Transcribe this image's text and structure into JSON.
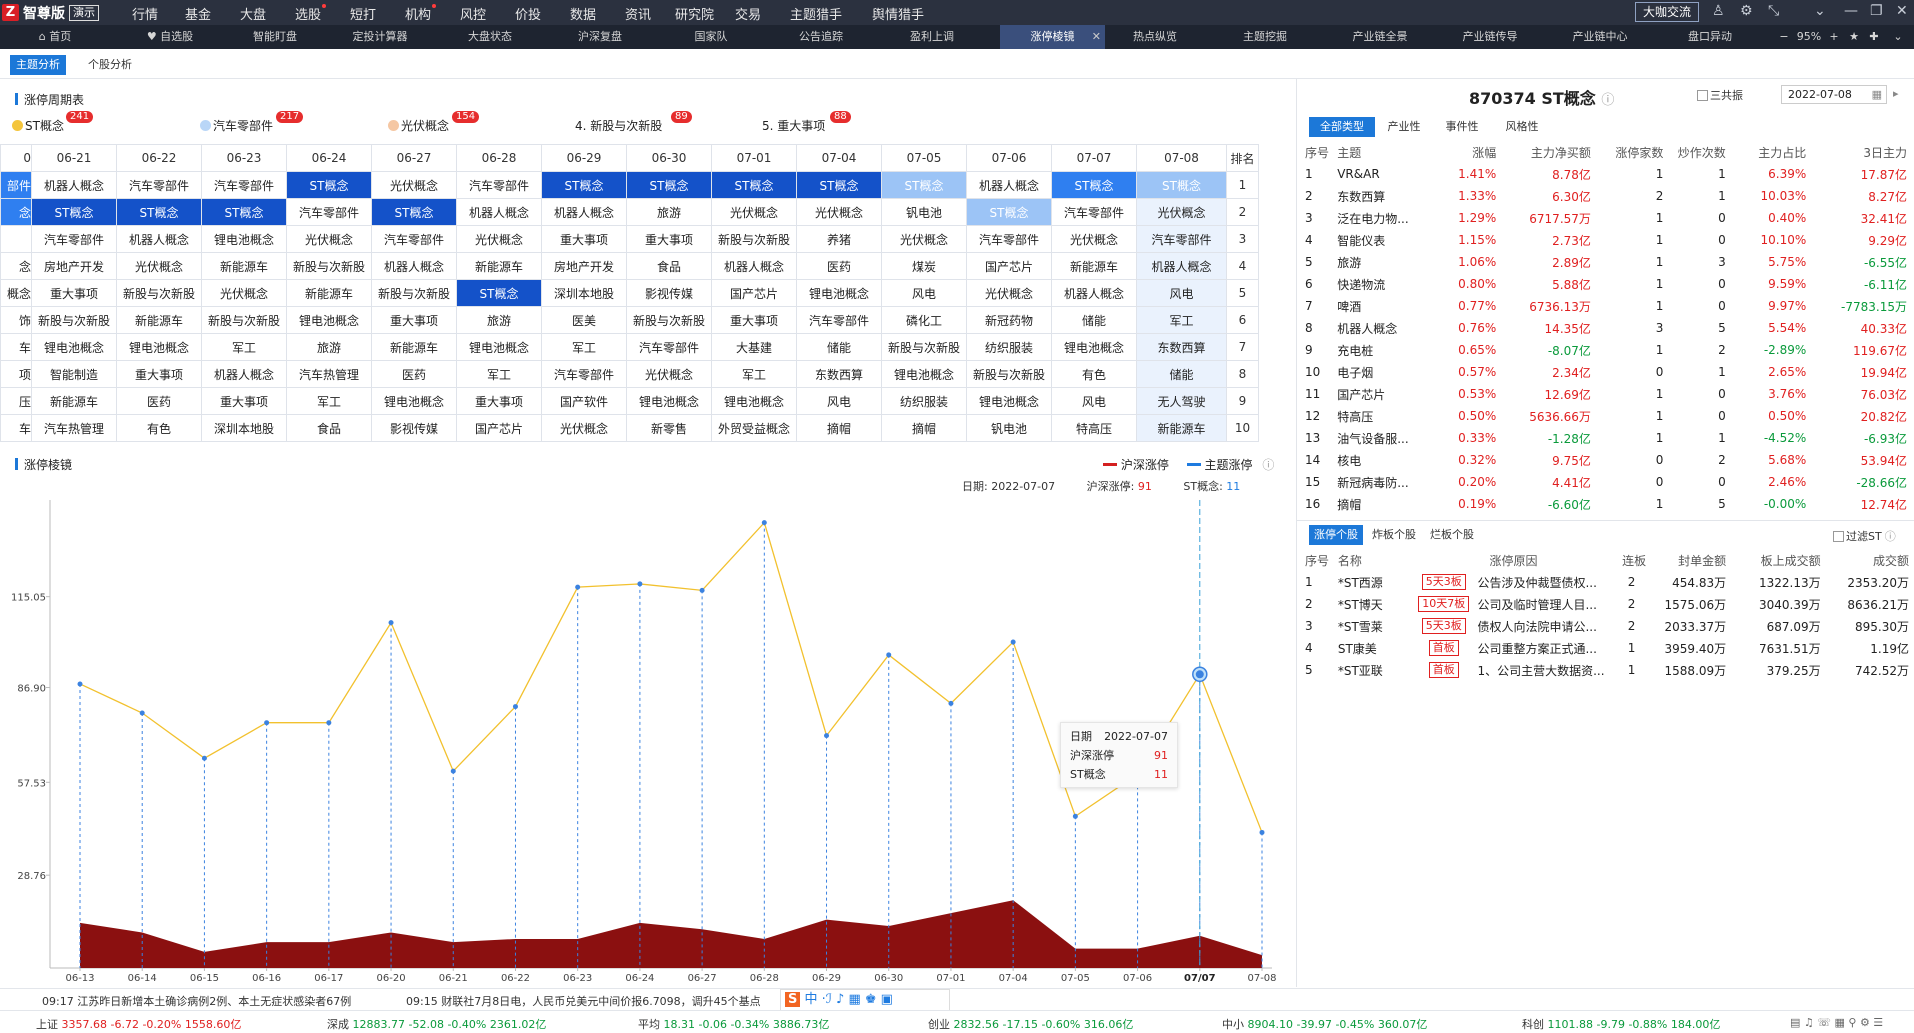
{
  "app": {
    "logo_mark": "Z",
    "name": "智尊版",
    "badge": "演示"
  },
  "menu": [
    "行情",
    "基金",
    "大盘",
    "选股",
    "短打",
    "机构",
    "风控",
    "价投",
    "数据",
    "资讯",
    "研究院",
    "交易",
    "主题猎手",
    "舆情猎手"
  ],
  "menu_right": "大咖交流",
  "tabs": [
    "首页",
    "自选股",
    "智能盯盘",
    "定投计算器",
    "大盘状态",
    "沪深复盘",
    "国家队",
    "公告追踪",
    "盈利上调",
    "涨停棱镜",
    "热点纵览",
    "主题挖掘",
    "产业链全景",
    "产业链传导",
    "产业链中心",
    "盘口异动"
  ],
  "active_tab": "涨停棱镜",
  "zoom": "95%",
  "subtabs": [
    "主题分析",
    "个股分析"
  ],
  "cycle": {
    "title": "涨停周期表",
    "legend": [
      {
        "label": "ST概念",
        "count": "241",
        "color": "#f4c53c"
      },
      {
        "label": "汽车零部件",
        "count": "217",
        "color": "#b9d6f7"
      },
      {
        "label": "光伏概念",
        "count": "154",
        "color": "#f5c7a3"
      },
      {
        "label": "4. 新股与次新股",
        "count": "89",
        "color": ""
      },
      {
        "label": "5. 重大事项",
        "count": "88",
        "color": ""
      }
    ],
    "dates": [
      "0",
      "06-21",
      "06-22",
      "06-23",
      "06-24",
      "06-27",
      "06-28",
      "06-29",
      "06-30",
      "07-01",
      "07-04",
      "07-05",
      "07-06",
      "07-07",
      "07-08"
    ],
    "rank_label": "排名",
    "rows": [
      [
        "部件",
        "机器人概念",
        "汽车零部件",
        "汽车零部件",
        "ST概念",
        "光伏概念",
        "汽车零部件",
        "ST概念",
        "ST概念",
        "ST概念",
        "ST概念",
        "ST概念",
        "机器人概念",
        "ST概念",
        "ST概念"
      ],
      [
        "念",
        "ST概念",
        "ST概念",
        "ST概念",
        "汽车零部件",
        "ST概念",
        "机器人概念",
        "机器人概念",
        "旅游",
        "光伏概念",
        "光伏概念",
        "钒电池",
        "ST概念",
        "汽车零部件",
        "光伏概念"
      ],
      [
        "",
        "汽车零部件",
        "机器人概念",
        "锂电池概念",
        "光伏概念",
        "汽车零部件",
        "光伏概念",
        "重大事项",
        "重大事项",
        "新股与次新股",
        "养猪",
        "光伏概念",
        "汽车零部件",
        "光伏概念",
        "汽车零部件"
      ],
      [
        "念",
        "房地产开发",
        "光伏概念",
        "新能源车",
        "新股与次新股",
        "机器人概念",
        "新能源车",
        "房地产开发",
        "食品",
        "机器人概念",
        "医药",
        "煤炭",
        "国产芯片",
        "新能源车",
        "机器人概念"
      ],
      [
        "概念",
        "重大事项",
        "新股与次新股",
        "光伏概念",
        "新能源车",
        "新股与次新股",
        "ST概念",
        "深圳本地股",
        "影视传媒",
        "国产芯片",
        "锂电池概念",
        "风电",
        "光伏概念",
        "机器人概念",
        "风电"
      ],
      [
        "饰",
        "新股与次新股",
        "新能源车",
        "新股与次新股",
        "锂电池概念",
        "重大事项",
        "旅游",
        "医美",
        "新股与次新股",
        "重大事项",
        "汽车零部件",
        "磷化工",
        "新冠药物",
        "储能",
        "军工"
      ],
      [
        "车",
        "锂电池概念",
        "锂电池概念",
        "军工",
        "旅游",
        "新能源车",
        "锂电池概念",
        "军工",
        "汽车零部件",
        "大基建",
        "储能",
        "新股与次新股",
        "纺织服装",
        "锂电池概念",
        "东数西算"
      ],
      [
        "项",
        "智能制造",
        "重大事项",
        "机器人概念",
        "汽车热管理",
        "医药",
        "军工",
        "汽车零部件",
        "光伏概念",
        "军工",
        "东数西算",
        "锂电池概念",
        "新股与次新股",
        "有色",
        "储能"
      ],
      [
        "压",
        "新能源车",
        "医药",
        "重大事项",
        "军工",
        "锂电池概念",
        "重大事项",
        "国产软件",
        "锂电池概念",
        "锂电池概念",
        "风电",
        "纺织服装",
        "锂电池概念",
        "风电",
        "无人驾驶"
      ],
      [
        "车",
        "汽车热管理",
        "有色",
        "深圳本地股",
        "食品",
        "影视传媒",
        "国产芯片",
        "光伏概念",
        "新零售",
        "外贸受益概念",
        "摘帽",
        "摘帽",
        "钒电池",
        "特高压",
        "新能源车"
      ]
    ],
    "ranks": [
      "1",
      "2",
      "3",
      "4",
      "5",
      "6",
      "7",
      "8",
      "9",
      "10"
    ]
  },
  "mirror": {
    "title": "涨停棱镜",
    "legend_hs": "沪深涨停",
    "legend_theme": "主题涨停",
    "info_date_label": "日期:",
    "info_date": "2022-07-07",
    "info_hs_label": "沪深涨停:",
    "info_hs": "91",
    "info_st_label": "ST概念:",
    "info_st": "11",
    "tooltip": {
      "l1": "日期",
      "v1": "2022-07-07",
      "l2": "沪深涨停",
      "v2": "91",
      "l3": "ST概念",
      "v3": "11"
    }
  },
  "chart_data": {
    "type": "line",
    "title": "涨停棱镜",
    "x": [
      "06-13",
      "06-14",
      "06-15",
      "06-16",
      "06-17",
      "06-20",
      "06-21",
      "06-22",
      "06-23",
      "06-24",
      "06-27",
      "06-28",
      "06-29",
      "06-30",
      "07-01",
      "07-04",
      "07-05",
      "07-06",
      "07-07",
      "07-08"
    ],
    "y_ticks": [
      "115.05",
      "86.90",
      "57.53",
      "28.76"
    ],
    "series": [
      {
        "name": "沪深涨停",
        "type": "line",
        "color": "#f2c12e",
        "values": [
          88,
          79,
          65,
          76,
          76,
          107,
          61,
          81,
          118,
          119,
          117,
          138,
          72,
          97,
          82,
          101,
          47,
          60,
          91,
          42
        ]
      },
      {
        "name": "ST概念",
        "type": "area",
        "color": "#8b1010",
        "values": [
          14,
          11,
          5,
          8,
          8,
          11,
          8,
          9,
          9,
          14,
          12,
          9,
          15,
          13,
          17,
          21,
          6,
          6,
          10,
          4
        ]
      }
    ],
    "highlight": "07/07"
  },
  "right": {
    "stock_code": "870374 ST概念",
    "sanlianzhen": "三共振",
    "date": "2022-07-08",
    "type_tabs": [
      "全部类型",
      "产业性",
      "事件性",
      "风格性"
    ],
    "themes_header": [
      "序号",
      "主题",
      "涨幅",
      "主力净买额",
      "涨停家数",
      "炒作次数",
      "主力占比",
      "3日主力"
    ],
    "themes": [
      [
        "1",
        "VR&AR",
        "1.41%",
        "8.78亿",
        "1",
        "1",
        "6.39%",
        "17.87亿"
      ],
      [
        "2",
        "东数西算",
        "1.33%",
        "6.30亿",
        "2",
        "1",
        "10.03%",
        "8.27亿"
      ],
      [
        "3",
        "泛在电力物...",
        "1.29%",
        "6717.57万",
        "1",
        "0",
        "0.40%",
        "32.41亿"
      ],
      [
        "4",
        "智能仪表",
        "1.15%",
        "2.73亿",
        "1",
        "0",
        "10.10%",
        "9.29亿"
      ],
      [
        "5",
        "旅游",
        "1.06%",
        "2.89亿",
        "1",
        "3",
        "5.75%",
        "-6.55亿"
      ],
      [
        "6",
        "快递物流",
        "0.80%",
        "5.88亿",
        "1",
        "0",
        "9.59%",
        "-6.11亿"
      ],
      [
        "7",
        "啤酒",
        "0.77%",
        "6736.13万",
        "1",
        "0",
        "9.97%",
        "-7783.15万"
      ],
      [
        "8",
        "机器人概念",
        "0.76%",
        "14.35亿",
        "3",
        "5",
        "5.54%",
        "40.33亿"
      ],
      [
        "9",
        "充电桩",
        "0.65%",
        "-8.07亿",
        "1",
        "2",
        "-2.89%",
        "119.67亿"
      ],
      [
        "10",
        "电子烟",
        "0.57%",
        "2.34亿",
        "0",
        "1",
        "2.65%",
        "19.94亿"
      ],
      [
        "11",
        "国产芯片",
        "0.53%",
        "12.69亿",
        "1",
        "0",
        "3.76%",
        "76.03亿"
      ],
      [
        "12",
        "特高压",
        "0.50%",
        "5636.66万",
        "1",
        "0",
        "0.50%",
        "20.82亿"
      ],
      [
        "13",
        "油气设备服...",
        "0.33%",
        "-1.28亿",
        "1",
        "1",
        "-4.52%",
        "-6.93亿"
      ],
      [
        "14",
        "核电",
        "0.32%",
        "9.75亿",
        "0",
        "2",
        "5.68%",
        "53.94亿"
      ],
      [
        "15",
        "新冠病毒防...",
        "0.20%",
        "4.41亿",
        "0",
        "0",
        "2.46%",
        "-28.66亿"
      ],
      [
        "16",
        "摘帽",
        "0.19%",
        "-6.60亿",
        "1",
        "5",
        "-0.00%",
        "12.74亿"
      ]
    ],
    "stock_tabs": [
      "涨停个股",
      "炸板个股",
      "烂板个股"
    ],
    "exclude_st": "过滤ST",
    "stocks_header": [
      "序号",
      "名称",
      "涨停原因",
      "连板",
      "封单金额",
      "板上成交额",
      "成交额"
    ],
    "stocks": [
      [
        "1",
        "*ST西源",
        "5天3板",
        "公告涉及仲裁暨债权...",
        "2",
        "454.83万",
        "1322.13万",
        "2353.20万"
      ],
      [
        "2",
        "*ST博天",
        "10天7板",
        "公司及临时管理人目...",
        "2",
        "1575.06万",
        "3040.39万",
        "8636.21万"
      ],
      [
        "3",
        "*ST雪莱",
        "5天3板",
        "债权人向法院申请公...",
        "2",
        "2033.37万",
        "687.09万",
        "895.30万"
      ],
      [
        "4",
        "ST康美",
        "首板",
        "公司重整方案正式通...",
        "1",
        "3959.40万",
        "7631.51万",
        "1.19亿"
      ],
      [
        "5",
        "*ST亚联",
        "首板",
        "1、公司主营大数据资...",
        "1",
        "1588.09万",
        "379.25万",
        "742.52万"
      ]
    ]
  },
  "news": [
    "09:17 江苏昨日新增本土确诊病例2例、本土无症状感染者67例",
    "09:15 财联社7月8日电，人民币兑美元中间价报6.7098，调升45个基点"
  ],
  "indices": [
    {
      "name": "上证",
      "vals": "3357.68 -6.72 -0.20% 1558.60亿"
    },
    {
      "name": "深成",
      "vals": "12883.77 -52.08 -0.40% 2361.02亿"
    },
    {
      "name": "平均",
      "vals": "18.31 -0.06 -0.34% 3886.73亿"
    },
    {
      "name": "创业",
      "vals": "2832.56 -17.15 -0.60% 316.06亿"
    },
    {
      "name": "中小",
      "vals": "8904.10 -39.97 -0.45% 360.07亿"
    },
    {
      "name": "科创",
      "vals": "1101.88 -9.79 -0.88% 184.00亿"
    }
  ]
}
